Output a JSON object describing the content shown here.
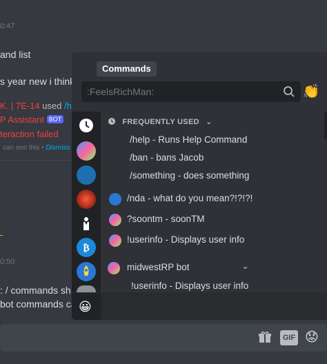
{
  "background": {
    "timestamp_top": "0:47",
    "line1": "and list",
    "line2": "s year new i think",
    "reply_author": "K. | 7E-14",
    "reply_used": "used",
    "reply_cmd": "/hel",
    "bot_name": "P Assistant",
    "bot_tag": "BOT",
    "error_text": "teraction failed",
    "ephemeral_text": "can see this •",
    "dismiss_text": "Dismiss",
    "timestamp_mid": "0:50",
    "line3": ": / commands sh",
    "line4": "bot commands ca"
  },
  "popup": {
    "title": "Commands",
    "search_placeholder": ":FeelsRichMan:",
    "emoji_button": "👏",
    "section_frequent": "FREQUENTLY USED",
    "frequent_commands": [
      "/help - Runs Help Command",
      "/ban - bans Jacob",
      "/something - does something"
    ],
    "other_commands": [
      "/nda - what do you mean?!?!?!",
      "?soontm - soonTM",
      "!userinfo - Displays user info"
    ],
    "section_bot": "midwestRP bot",
    "bot_commands": [
      "!userinfo - Displays user info"
    ],
    "side_bottom_icon": "😀"
  },
  "composer": {
    "gif_label": "GIF",
    "emoji": "😟"
  },
  "colors": {
    "background": "#36393f",
    "popup": "#2f3136",
    "sidebar": "#202225",
    "accent": "#00aff4",
    "error": "#ed4245",
    "bot_tag": "#5865f2"
  }
}
